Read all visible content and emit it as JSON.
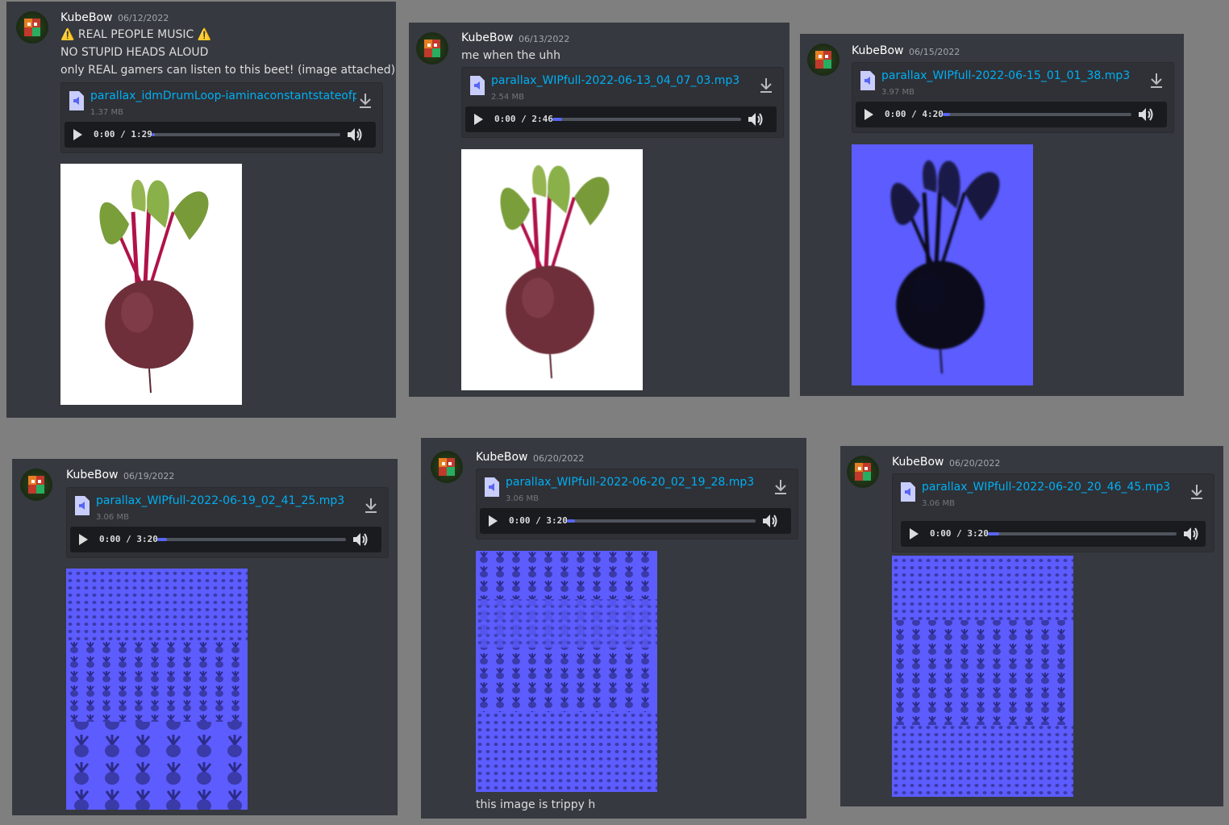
{
  "messages": [
    {
      "username": "KubeBow",
      "date": "06/12/2022",
      "lines": [
        "⚠️ REAL PEOPLE MUSIC ⚠️",
        "NO STUPID HEADS ALOUD",
        "only REAL gamers can listen to this beet! (image attached)"
      ],
      "file": {
        "name": "parallax_idmDrumLoop-iaminaconstantstateofpa",
        "size": "1.37 MB",
        "time": "0:00 / 1:29"
      }
    },
    {
      "username": "KubeBow",
      "date": "06/13/2022",
      "lines": [
        "me when the uhh"
      ],
      "file": {
        "name": "parallax_WIPfull-2022-06-13_04_07_03.mp3",
        "size": "2.54 MB",
        "time": "0:00 / 2:46"
      }
    },
    {
      "username": "KubeBow",
      "date": "06/15/2022",
      "lines": [],
      "file": {
        "name": "parallax_WIPfull-2022-06-15_01_01_38.mp3",
        "size": "3.97 MB",
        "time": "0:00 / 4:20"
      }
    },
    {
      "username": "KubeBow",
      "date": "06/19/2022",
      "lines": [],
      "file": {
        "name": "parallax_WIPfull-2022-06-19_02_41_25.mp3",
        "size": "3.06 MB",
        "time": "0:00 / 3:20"
      }
    },
    {
      "username": "KubeBow",
      "date": "06/20/2022",
      "lines": [
        "this image is trippy h"
      ],
      "file": {
        "name": "parallax_WIPfull-2022-06-20_02_19_28.mp3",
        "size": "3.06 MB",
        "time": "0:00 / 3:20"
      }
    },
    {
      "username": "KubeBow",
      "date": "06/20/2022",
      "lines": [],
      "file": {
        "name": "parallax_WIPfull-2022-06-20_20_46_45.mp3",
        "size": "3.06 MB",
        "time": "0:00 / 3:20"
      }
    }
  ],
  "colors": {
    "accent": "#5865f2",
    "link": "#00aff4",
    "panel": "#36393f",
    "background": "#7f7f7f",
    "tint": "#5c5cff"
  },
  "icons": [
    "file-audio-icon",
    "download-icon",
    "play-icon",
    "volume-icon"
  ]
}
